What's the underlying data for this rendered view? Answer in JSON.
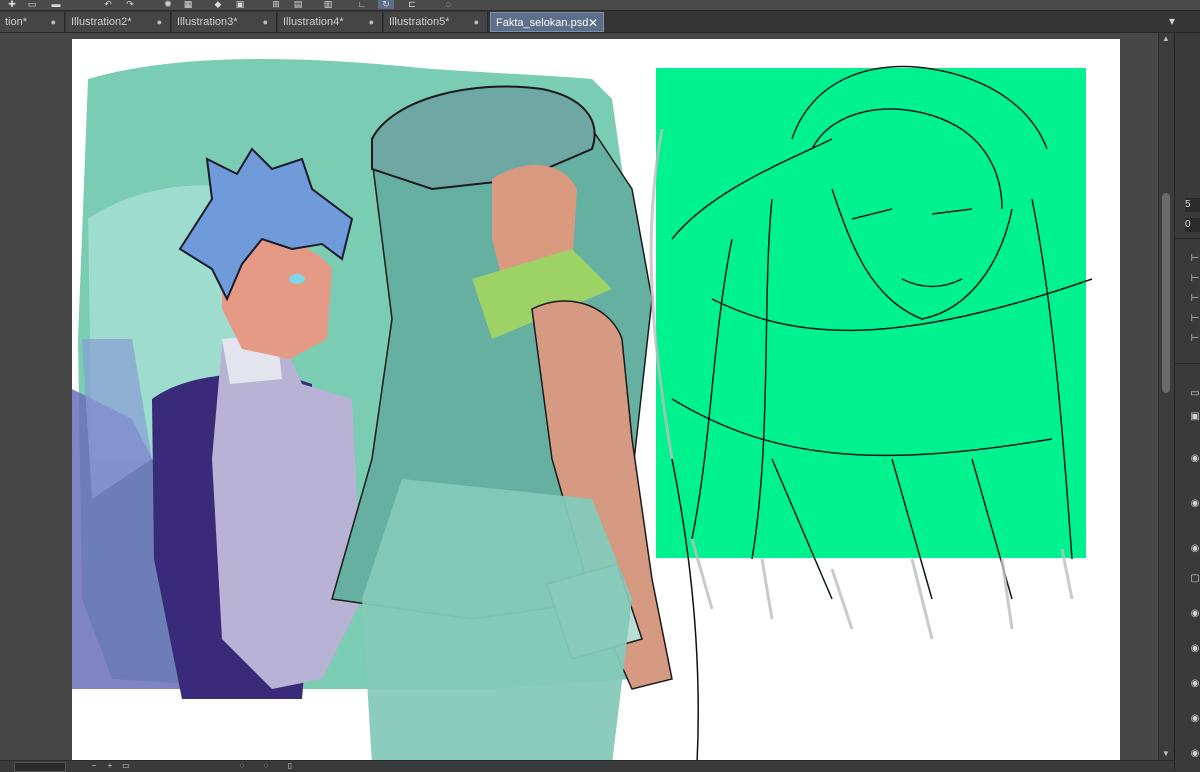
{
  "tabs": [
    {
      "label": "tion*",
      "modified": true
    },
    {
      "label": "Illustration2*",
      "modified": true
    },
    {
      "label": "Illustration3*",
      "modified": true
    },
    {
      "label": "Illustration4*",
      "modified": true
    },
    {
      "label": "Illustration5*",
      "modified": true
    },
    {
      "label": "Fakta_selokan.psd",
      "active": true
    }
  ],
  "tab_markers": {
    "modified_dot": "●",
    "close": "✕",
    "menu": "▾"
  },
  "right_panel": {
    "value1": "5",
    "value2": "0"
  },
  "colors": {
    "canvas_bg": "#ffffff",
    "workspace_bg": "#474747",
    "active_tab": "#5d6e8a",
    "sketch_box": "#00f28f",
    "teal_bg": "#6cc6ab"
  },
  "icons": [
    "new-file-icon",
    "open-folder-icon",
    "undo-icon",
    "redo-icon",
    "lasso-icon",
    "transform-icon",
    "brush-icon",
    "camera-icon"
  ]
}
